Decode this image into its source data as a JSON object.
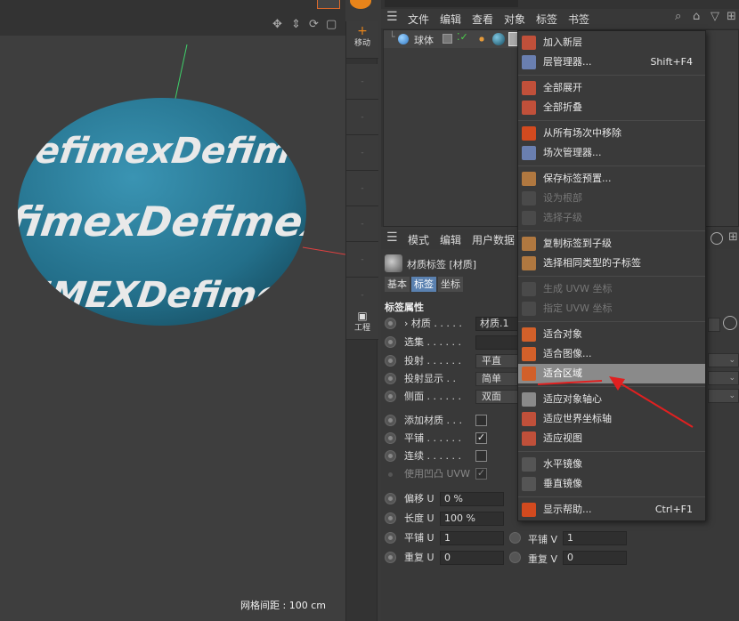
{
  "viewport": {
    "grid_readout": "网格间距 : 100 cm",
    "texture_words": [
      "Defimex",
      "DEFIMEX"
    ],
    "axis_colors": {
      "y": "#3fd06a",
      "x": "#e04040"
    }
  },
  "side_toolbar": {
    "top_label": "移动",
    "bottom_label": "工程"
  },
  "object_manager": {
    "menu": [
      "文件",
      "编辑",
      "查看",
      "对象",
      "标签",
      "书签"
    ],
    "object_name": "球体"
  },
  "attribute_manager": {
    "menu": [
      "模式",
      "编辑",
      "用户数据"
    ],
    "title": "材质标签 [材质]",
    "tabs": [
      "基本",
      "标签",
      "坐标"
    ],
    "section": "标签属性",
    "rows": [
      {
        "label": "› 材质 . . . . .",
        "value": "材质.1"
      },
      {
        "label": "选集 . . . . . .",
        "value": ""
      },
      {
        "label": "投射 . . . . . .",
        "value": "平直"
      },
      {
        "label": "投射显示 . .",
        "value": "简单"
      },
      {
        "label": "侧面 . . . . . .",
        "value": "双面"
      }
    ],
    "checks": [
      {
        "label": "添加材质 . . .",
        "checked": false
      },
      {
        "label": "平铺 . . . . . .",
        "checked": true
      },
      {
        "label": "连续 . . . . . .",
        "checked": false
      },
      {
        "label": "使用凹凸 UVW",
        "checked": true
      }
    ],
    "offset_u": {
      "label": "偏移 U",
      "value": "0 %"
    },
    "length_u": {
      "label": "长度 U",
      "value": "100 %"
    },
    "tile_u": {
      "label": "平铺 U",
      "value": "1"
    },
    "repeat_u": {
      "label": "重复 U",
      "value": "0"
    },
    "tile_v": {
      "label": "平铺 V",
      "value": "1"
    },
    "repeat_v": {
      "label": "重复 V",
      "value": "0"
    }
  },
  "context_menu": {
    "items": [
      {
        "label": "加入新层",
        "shortcut": "",
        "disabled": false,
        "icon": "layer-add-icon"
      },
      {
        "label": "层管理器...",
        "shortcut": "Shift+F4",
        "disabled": false,
        "icon": "layer-manager-icon"
      },
      {
        "label": "全部展开",
        "shortcut": "",
        "disabled": false,
        "icon": "expand-all-icon"
      },
      {
        "label": "全部折叠",
        "shortcut": "",
        "disabled": false,
        "icon": "collapse-all-icon"
      },
      {
        "label": "从所有场次中移除",
        "shortcut": "",
        "disabled": false,
        "icon": "take-remove-icon"
      },
      {
        "label": "场次管理器...",
        "shortcut": "",
        "disabled": false,
        "icon": "take-manager-icon"
      },
      {
        "label": "保存标签预置...",
        "shortcut": "",
        "disabled": false,
        "icon": "save-preset-icon"
      },
      {
        "label": "设为根部",
        "shortcut": "",
        "disabled": true,
        "icon": "set-root-icon"
      },
      {
        "label": "选择子级",
        "shortcut": "",
        "disabled": true,
        "icon": "select-children-icon"
      },
      {
        "label": "复制标签到子级",
        "shortcut": "",
        "disabled": false,
        "icon": "copy-tag-icon"
      },
      {
        "label": "选择相同类型的子标签",
        "shortcut": "",
        "disabled": false,
        "icon": "select-same-tag-icon"
      },
      {
        "label": "生成 UVW 坐标",
        "shortcut": "",
        "disabled": true,
        "icon": "generate-uvw-icon"
      },
      {
        "label": "指定 UVW 坐标",
        "shortcut": "",
        "disabled": true,
        "icon": "assign-uvw-icon"
      },
      {
        "label": "适合对象",
        "shortcut": "",
        "disabled": false,
        "icon": "fit-object-icon"
      },
      {
        "label": "适合图像...",
        "shortcut": "",
        "disabled": false,
        "icon": "fit-image-icon"
      },
      {
        "label": "适合区域",
        "shortcut": "",
        "disabled": false,
        "highlighted": true,
        "icon": "fit-region-icon"
      },
      {
        "label": "适应对象轴心",
        "shortcut": "",
        "disabled": false,
        "icon": "fit-object-axis-icon"
      },
      {
        "label": "适应世界坐标轴",
        "shortcut": "",
        "disabled": false,
        "icon": "fit-world-axis-icon"
      },
      {
        "label": "适应视图",
        "shortcut": "",
        "disabled": false,
        "icon": "fit-view-icon"
      },
      {
        "label": "水平镜像",
        "shortcut": "",
        "disabled": false,
        "icon": "mirror-horizontal-icon"
      },
      {
        "label": "垂直镜像",
        "shortcut": "",
        "disabled": false,
        "icon": "mirror-vertical-icon"
      },
      {
        "label": "显示帮助...",
        "shortcut": "Ctrl+F1",
        "disabled": false,
        "icon": "help-icon"
      }
    ]
  },
  "annotation": {
    "color": "#e02020"
  }
}
